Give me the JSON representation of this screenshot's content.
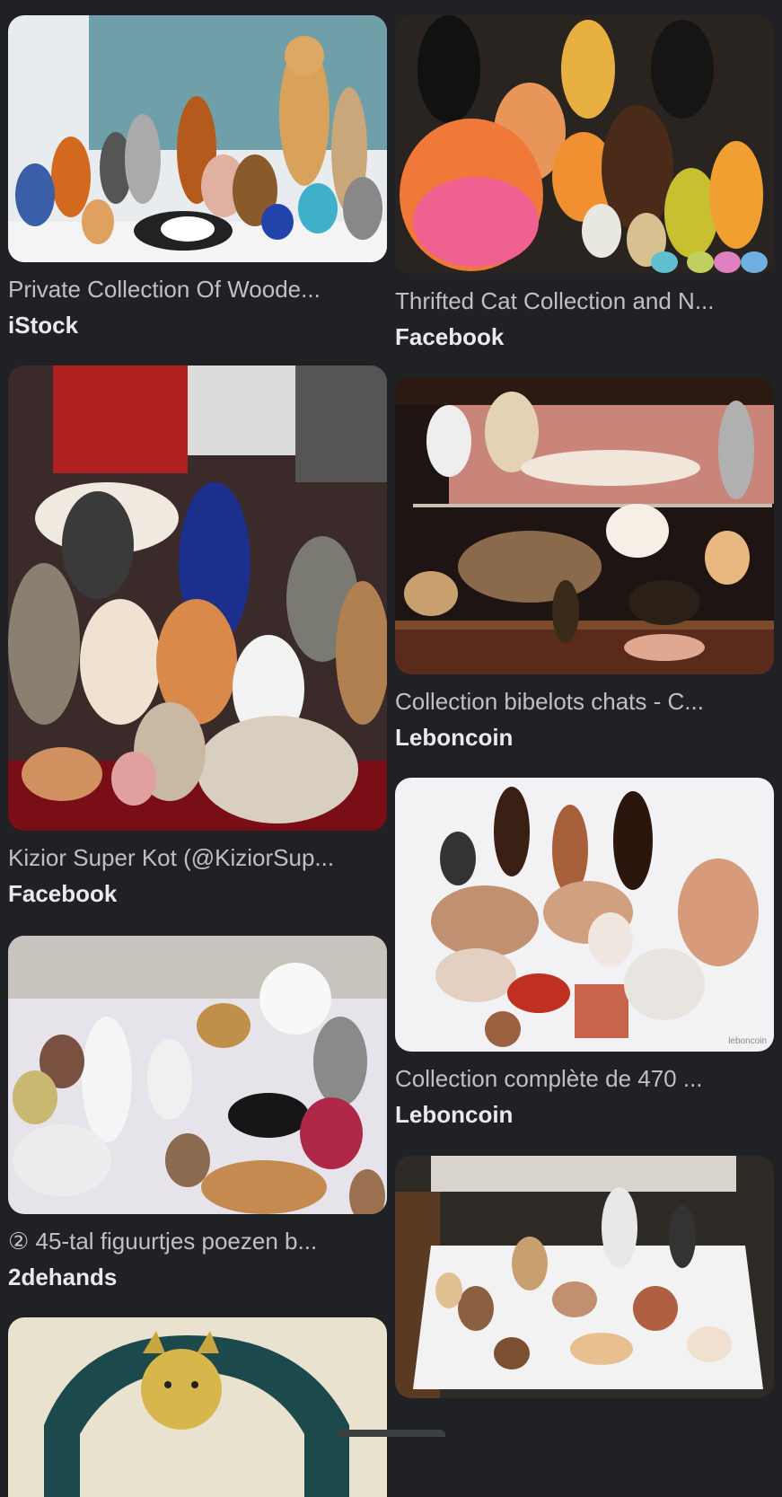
{
  "results": [
    {
      "caption": "Private Collection Of Woode...",
      "source": "iStock"
    },
    {
      "caption": "Thrifted Cat Collection and N...",
      "source": "Facebook"
    },
    {
      "caption": "Kizior Super Kot (@KiziorSup...",
      "source": "Facebook"
    },
    {
      "caption": "Collection bibelots chats - C...",
      "source": "Leboncoin"
    },
    {
      "caption": "② 45-tal figuurtjes poezen b...",
      "source": "2dehands"
    },
    {
      "caption": "Collection complète de 470 ...",
      "source": "Leboncoin",
      "watermark": "leboncoin"
    },
    {
      "caption": "",
      "source": ""
    },
    {
      "caption": "",
      "source": ""
    }
  ],
  "colors": {
    "background": "#202124",
    "caption": "#bdc1c6",
    "source": "#e8eaed"
  }
}
